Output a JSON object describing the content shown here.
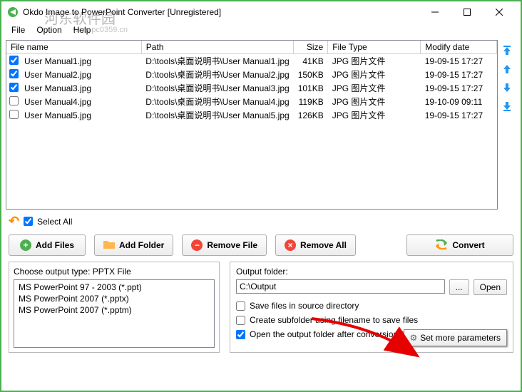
{
  "window": {
    "title": "Okdo Image to PowerPoint Converter [Unregistered]"
  },
  "menu": {
    "file": "File",
    "option": "Option",
    "help": "Help"
  },
  "table": {
    "headers": {
      "filename": "File name",
      "path": "Path",
      "size": "Size",
      "filetype": "File Type",
      "modifydate": "Modify date"
    },
    "rows": [
      {
        "checked": true,
        "name": "User Manual1.jpg",
        "path": "D:\\tools\\桌面说明书\\User Manual1.jpg",
        "size": "41KB",
        "type": "JPG 图片文件",
        "date": "19-09-15 17:27"
      },
      {
        "checked": true,
        "name": "User Manual2.jpg",
        "path": "D:\\tools\\桌面说明书\\User Manual2.jpg",
        "size": "150KB",
        "type": "JPG 图片文件",
        "date": "19-09-15 17:27"
      },
      {
        "checked": true,
        "name": "User Manual3.jpg",
        "path": "D:\\tools\\桌面说明书\\User Manual3.jpg",
        "size": "101KB",
        "type": "JPG 图片文件",
        "date": "19-09-15 17:27"
      },
      {
        "checked": false,
        "name": "User Manual4.jpg",
        "path": "D:\\tools\\桌面说明书\\User Manual4.jpg",
        "size": "119KB",
        "type": "JPG 图片文件",
        "date": "19-10-09 09:11"
      },
      {
        "checked": false,
        "name": "User Manual5.jpg",
        "path": "D:\\tools\\桌面说明书\\User Manual5.jpg",
        "size": "126KB",
        "type": "JPG 图片文件",
        "date": "19-09-15 17:27"
      }
    ]
  },
  "selectall": {
    "label": "Select All",
    "checked": true
  },
  "buttons": {
    "addfiles": "Add Files",
    "addfolder": "Add Folder",
    "removefile": "Remove File",
    "removeall": "Remove All",
    "convert": "Convert"
  },
  "outputtype": {
    "label": "Choose output type:  PPTX File",
    "options": [
      "MS PowerPoint 97 - 2003 (*.ppt)",
      "MS PowerPoint 2007 (*.pptx)",
      "MS PowerPoint 2007 (*.pptm)"
    ]
  },
  "outputfolder": {
    "label": "Output folder:",
    "value": "C:\\Output",
    "browse": "...",
    "open": "Open"
  },
  "checks": {
    "savesource": {
      "label": "Save files in source directory",
      "checked": false
    },
    "subfolder": {
      "label": "Create subfolder using filename to save files",
      "checked": false
    },
    "openafter": {
      "label": "Open the output folder after conversion finished",
      "checked": true
    }
  },
  "setmore": "Set more parameters",
  "watermark": {
    "text": "河东软件园",
    "url": "www.pc0359.cn"
  }
}
